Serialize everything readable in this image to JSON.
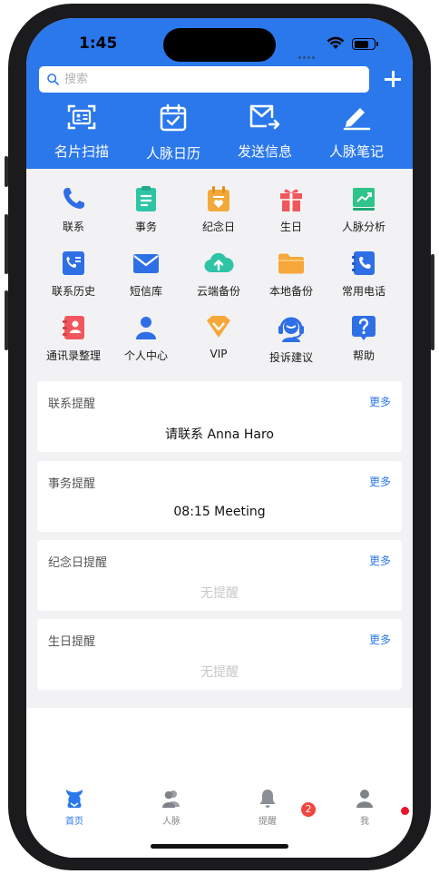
{
  "status": {
    "time": "1:45"
  },
  "search": {
    "placeholder": "搜索"
  },
  "quick_actions": [
    {
      "label": "名片扫描",
      "icon": "card-scan-icon"
    },
    {
      "label": "人脉日历",
      "icon": "calendar-icon"
    },
    {
      "label": "发送信息",
      "icon": "send-mail-icon"
    },
    {
      "label": "人脉笔记",
      "icon": "pen-note-icon"
    }
  ],
  "grid": [
    {
      "label": "联系",
      "icon": "phone-icon",
      "color": "#2f6fe6"
    },
    {
      "label": "事务",
      "icon": "clipboard-icon",
      "color": "#2ec4a6"
    },
    {
      "label": "纪念日",
      "icon": "calendar-heart-icon",
      "color": "#f2a93b"
    },
    {
      "label": "生日",
      "icon": "gift-icon",
      "color": "#f0575d"
    },
    {
      "label": "人脉分析",
      "icon": "chart-icon",
      "color": "#2ec48a"
    },
    {
      "label": "联系历史",
      "icon": "contact-history-icon",
      "color": "#2f6fe6"
    },
    {
      "label": "短信库",
      "icon": "envelope-icon",
      "color": "#2f6fe6"
    },
    {
      "label": "云端备份",
      "icon": "cloud-upload-icon",
      "color": "#2ec4a6"
    },
    {
      "label": "本地备份",
      "icon": "folder-icon",
      "color": "#f7a83a"
    },
    {
      "label": "常用电话",
      "icon": "phone-book-icon",
      "color": "#2f6fe6"
    },
    {
      "label": "通讯录整理",
      "icon": "contacts-book-icon",
      "color": "#f0575d"
    },
    {
      "label": "个人中心",
      "icon": "person-icon",
      "color": "#2f6fe6"
    },
    {
      "label": "VIP",
      "icon": "vip-diamond-icon",
      "color": "#f7a83a"
    },
    {
      "label": "投诉建议",
      "icon": "headset-icon",
      "color": "#2f6fe6"
    },
    {
      "label": "帮助",
      "icon": "help-icon",
      "color": "#2f6fe6"
    }
  ],
  "reminders": [
    {
      "title": "联系提醒",
      "more": "更多",
      "content": "请联系 Anna Haro",
      "empty": false
    },
    {
      "title": "事务提醒",
      "more": "更多",
      "content": "08:15 Meeting",
      "empty": false
    },
    {
      "title": "纪念日提醒",
      "more": "更多",
      "content": "无提醒",
      "empty": true
    },
    {
      "title": "生日提醒",
      "more": "更多",
      "content": "无提醒",
      "empty": true
    }
  ],
  "tabbar": [
    {
      "label": "首页",
      "active": true
    },
    {
      "label": "人脉",
      "active": false
    },
    {
      "label": "提醒",
      "active": false,
      "badge": "2"
    },
    {
      "label": "我",
      "active": false,
      "dot": true
    }
  ],
  "colors": {
    "brand": "#2b78ec",
    "badge": "#f2453d",
    "background": "#f2f2f4"
  }
}
